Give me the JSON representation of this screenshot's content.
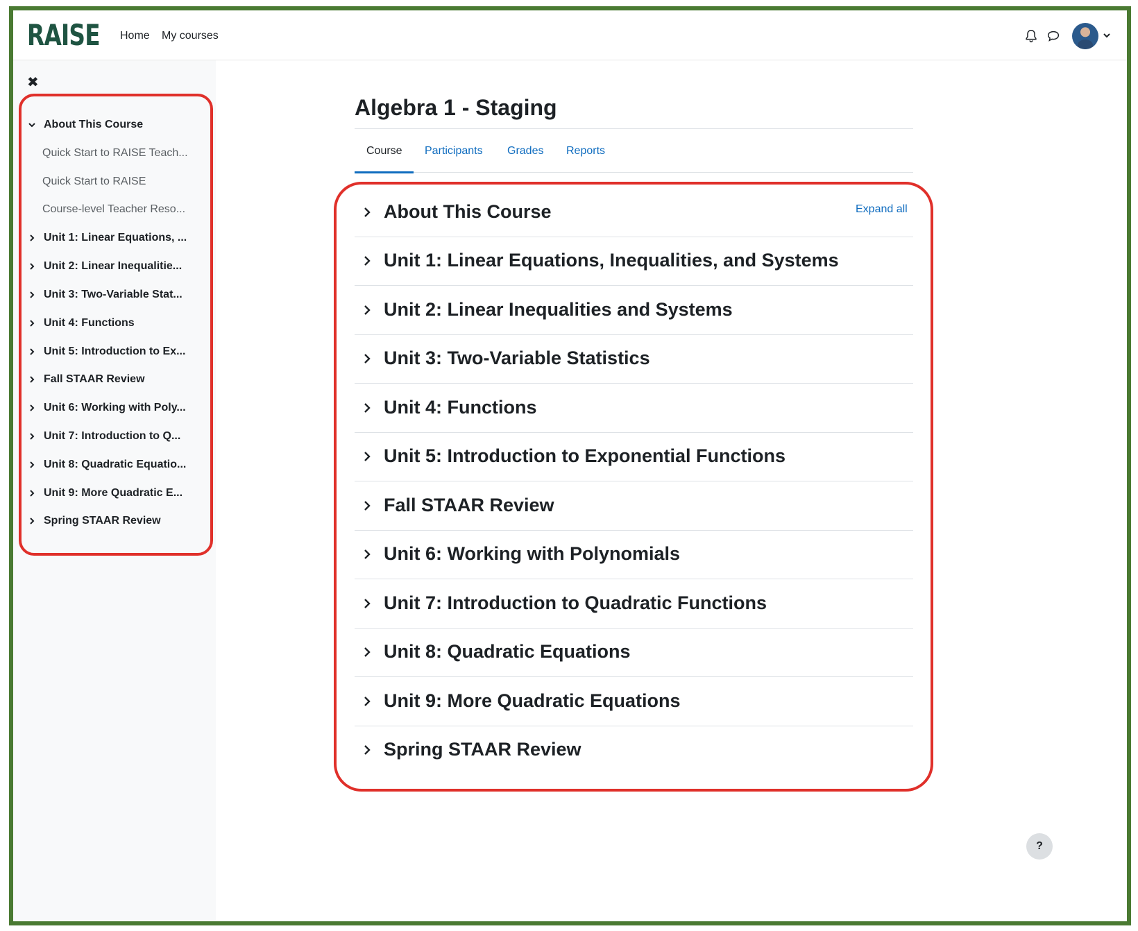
{
  "navbar": {
    "logo": "RAISE",
    "links": [
      "Home",
      "My courses"
    ]
  },
  "drawer": {
    "close_glyph": "✖",
    "items": [
      {
        "label": "About This Course",
        "expanded": true,
        "children": [
          "Quick Start to RAISE Teach...",
          "Quick Start to RAISE",
          "Course-level Teacher Reso..."
        ]
      },
      {
        "label": "Unit 1: Linear Equations, ..."
      },
      {
        "label": "Unit 2: Linear Inequalitie..."
      },
      {
        "label": "Unit 3: Two-Variable Stat..."
      },
      {
        "label": "Unit 4: Functions"
      },
      {
        "label": "Unit 5: Introduction to Ex..."
      },
      {
        "label": "Fall STAAR Review"
      },
      {
        "label": "Unit 6: Working with Poly..."
      },
      {
        "label": "Unit 7: Introduction to Q..."
      },
      {
        "label": "Unit 8: Quadratic Equatio..."
      },
      {
        "label": "Unit 9: More Quadratic E..."
      },
      {
        "label": "Spring STAAR Review"
      }
    ]
  },
  "course": {
    "title": "Algebra 1 - Staging",
    "tabs": [
      "Course",
      "Participants",
      "Grades",
      "Reports"
    ],
    "active_tab": "Course",
    "expand_all": "Expand all",
    "sections": [
      "About This Course",
      "Unit 1: Linear Equations, Inequalities, and Systems",
      "Unit 2: Linear Inequalities and Systems",
      "Unit 3: Two-Variable Statistics",
      "Unit 4: Functions",
      "Unit 5: Introduction to Exponential Functions",
      "Fall STAAR Review",
      "Unit 6: Working with Polynomials",
      "Unit 7: Introduction to Quadratic Functions",
      "Unit 8: Quadratic Equations",
      "Unit 9: More Quadratic Equations",
      "Spring STAAR Review"
    ]
  },
  "help": "?",
  "colors": {
    "brand": "#1f5442",
    "link": "#0f6cbf",
    "highlight": "#e0302a",
    "frame": "#4a7a32"
  }
}
